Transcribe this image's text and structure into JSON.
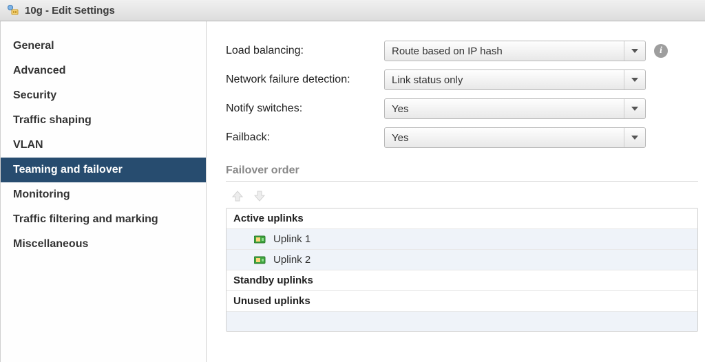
{
  "title": "10g - Edit Settings",
  "sidebar": {
    "items": [
      {
        "label": "General"
      },
      {
        "label": "Advanced"
      },
      {
        "label": "Security"
      },
      {
        "label": "Traffic shaping"
      },
      {
        "label": "VLAN"
      },
      {
        "label": "Teaming and failover"
      },
      {
        "label": "Monitoring"
      },
      {
        "label": "Traffic filtering and marking"
      },
      {
        "label": "Miscellaneous"
      }
    ],
    "selected_index": 5
  },
  "settings": {
    "load_balancing": {
      "label": "Load balancing:",
      "value": "Route based on IP hash"
    },
    "failure_detection": {
      "label": "Network failure detection:",
      "value": "Link status only"
    },
    "notify_switches": {
      "label": "Notify switches:",
      "value": "Yes"
    },
    "failback": {
      "label": "Failback:",
      "value": "Yes"
    }
  },
  "failover": {
    "section_label": "Failover order",
    "groups": {
      "active": {
        "label": "Active uplinks",
        "items": [
          "Uplink 1",
          "Uplink 2"
        ]
      },
      "standby": {
        "label": "Standby uplinks",
        "items": []
      },
      "unused": {
        "label": "Unused uplinks",
        "items": []
      }
    }
  }
}
